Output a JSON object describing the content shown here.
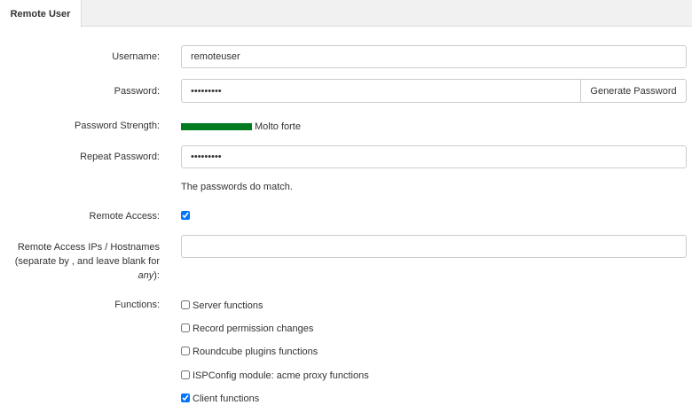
{
  "tab": {
    "label": "Remote User"
  },
  "form": {
    "username": {
      "label": "Username:",
      "value": "remoteuser"
    },
    "password": {
      "label": "Password:",
      "value": "•••••••••"
    },
    "generate_button": "Generate Password",
    "strength": {
      "label": "Password Strength:",
      "text": "Molto forte",
      "level": 1.0,
      "color": "#007b1f"
    },
    "repeat": {
      "label": "Repeat Password:",
      "value": "•••••••••"
    },
    "match_note": "The passwords do match.",
    "remote_access": {
      "label": "Remote Access:",
      "checked": true
    },
    "ips": {
      "label_line1": "Remote Access IPs / Hostnames",
      "label_line2": "(separate by , and leave blank for",
      "label_any": "any",
      "label_end": "):",
      "value": ""
    },
    "functions": {
      "label": "Functions:",
      "items": [
        {
          "label": "Server functions",
          "checked": false
        },
        {
          "label": "Record permission changes",
          "checked": false
        },
        {
          "label": "Roundcube plugins functions",
          "checked": false
        },
        {
          "label": "ISPConfig module: acme proxy functions",
          "checked": false
        },
        {
          "label": "Client functions",
          "checked": true
        }
      ]
    }
  }
}
